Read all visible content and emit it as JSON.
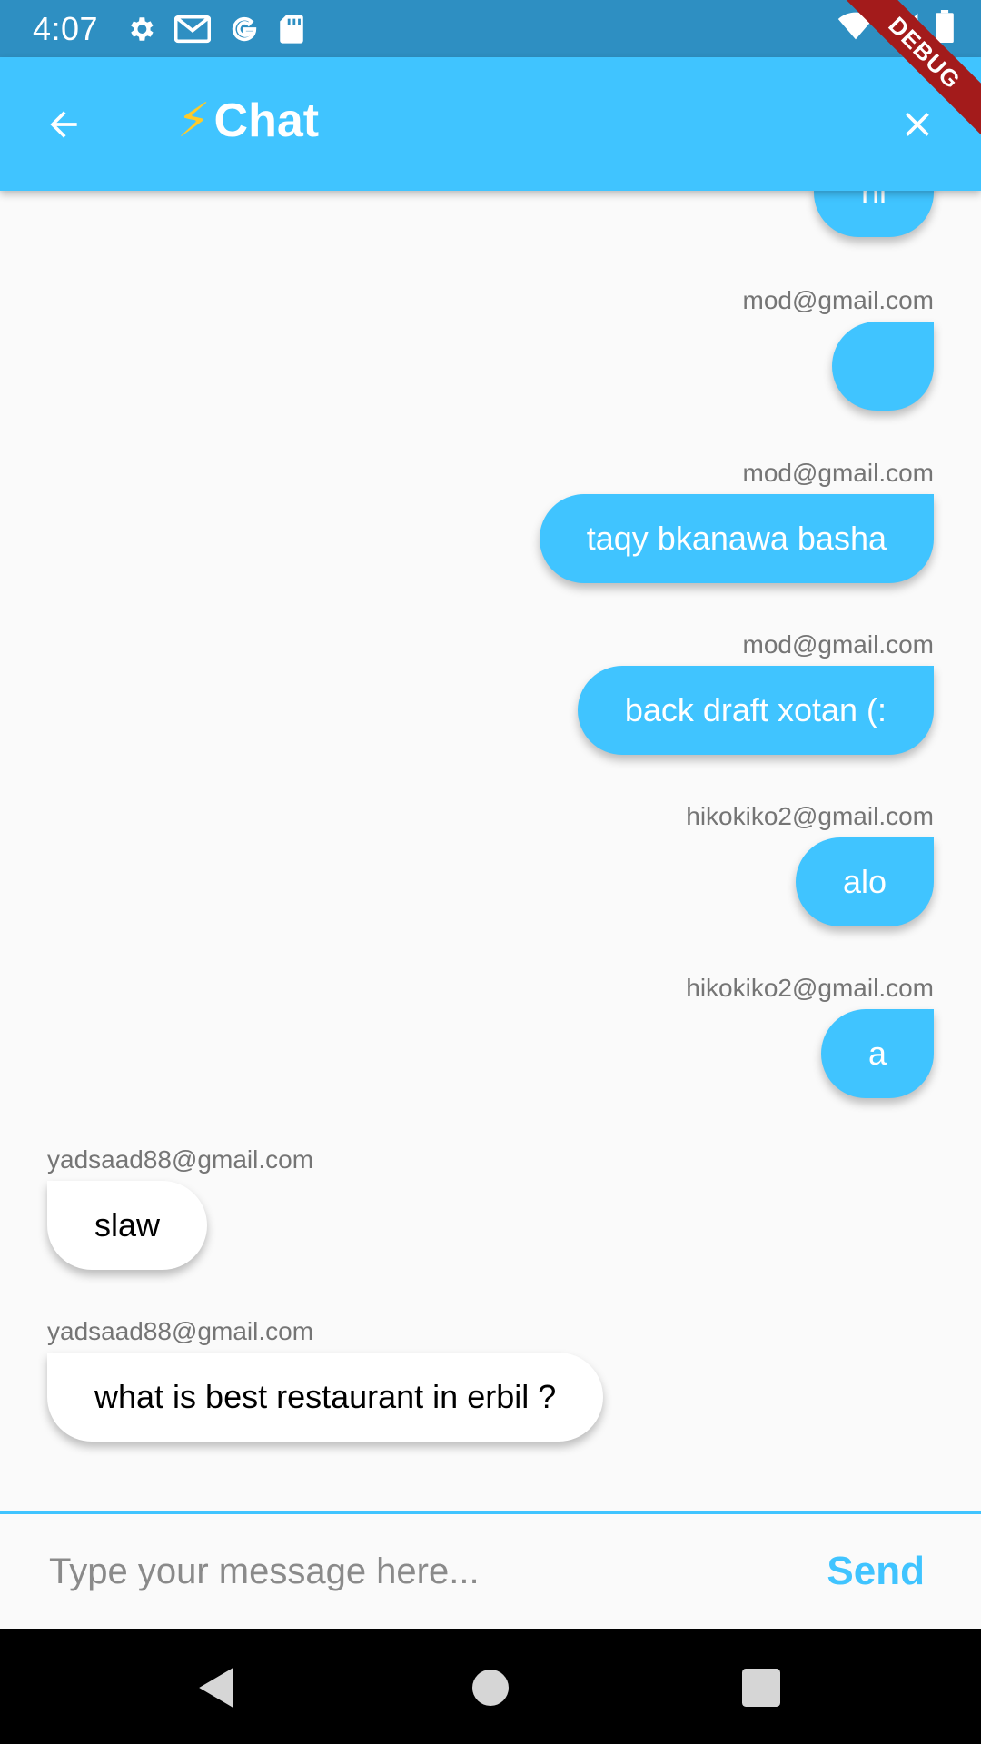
{
  "status_bar": {
    "time": "4:07",
    "icons": [
      "settings-icon",
      "gmail-icon",
      "google-icon",
      "sd-card-icon",
      "wifi-icon",
      "signal-icon",
      "battery-icon"
    ]
  },
  "app_bar": {
    "title": "Chat",
    "emoji": "⚡",
    "background": "#40c4ff"
  },
  "debug_banner": "DEBUG",
  "messages": [
    {
      "sender": "",
      "text": "hi",
      "mine": true
    },
    {
      "sender": "mod@gmail.com",
      "text": "",
      "mine": true
    },
    {
      "sender": "mod@gmail.com",
      "text": "taqy bkanawa basha",
      "mine": true
    },
    {
      "sender": "mod@gmail.com",
      "text": "back draft xotan (:",
      "mine": true
    },
    {
      "sender": "hikokiko2@gmail.com",
      "text": "alo",
      "mine": true
    },
    {
      "sender": "hikokiko2@gmail.com",
      "text": "a",
      "mine": true
    },
    {
      "sender": "yadsaad88@gmail.com",
      "text": "slaw",
      "mine": false
    },
    {
      "sender": "yadsaad88@gmail.com",
      "text": "what is best restaurant in erbil ?",
      "mine": false
    }
  ],
  "composer": {
    "placeholder": "Type your message here...",
    "value": "",
    "send_label": "Send"
  },
  "colors": {
    "accent": "#40c4ff",
    "status_bar": "#2e8fc2",
    "nav_bar": "#000000",
    "debug": "#a31b1b"
  }
}
